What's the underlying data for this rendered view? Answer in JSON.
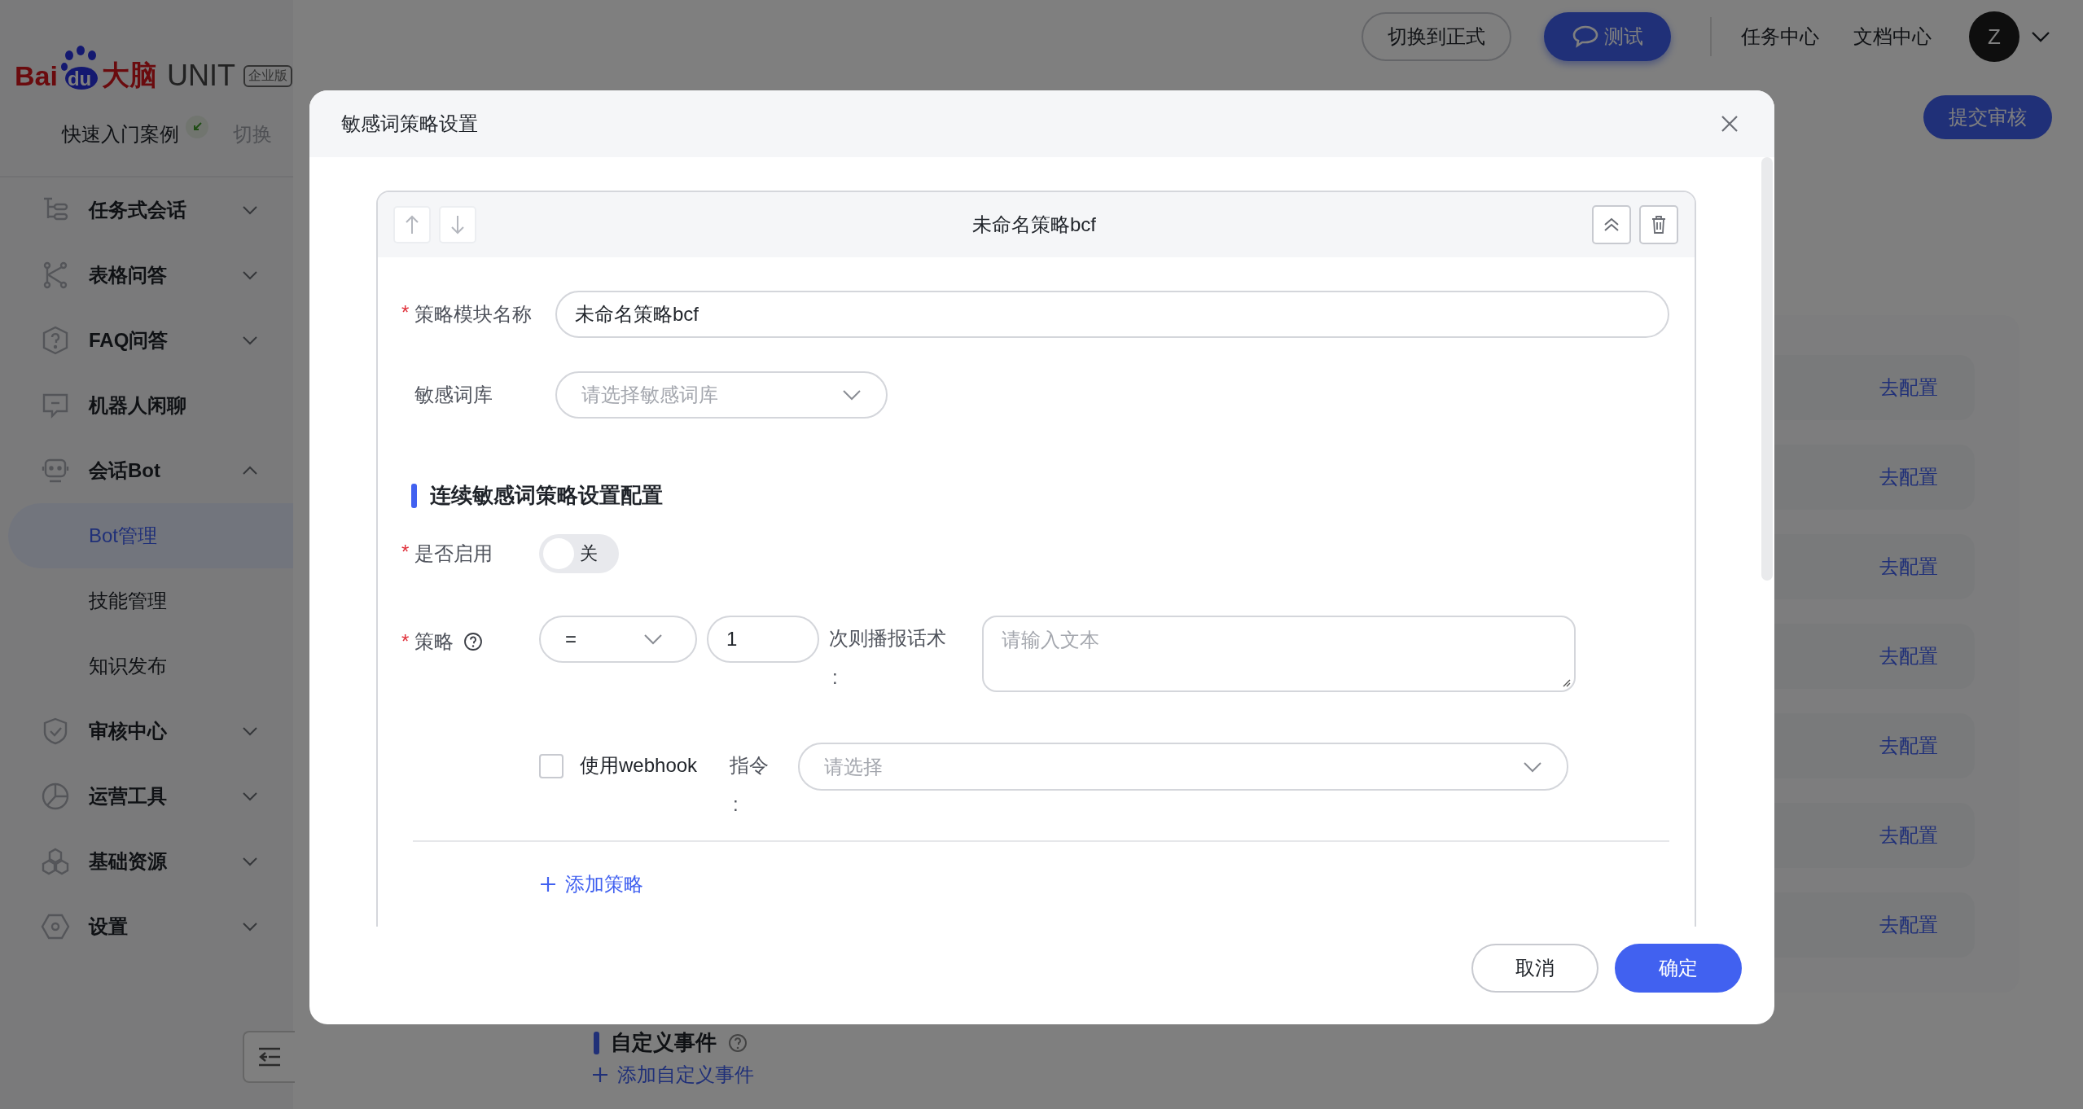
{
  "sidebar": {
    "logo": {
      "brand": "Bai",
      "paw_text": "du",
      "brand_cn": "大脑",
      "product": "UNIT",
      "edition": "企业版"
    },
    "quick_start": {
      "label": "快速入门案例",
      "switch": "切换"
    },
    "menu": [
      {
        "label": "任务式会话",
        "kind": "group",
        "expanded": false
      },
      {
        "label": "表格问答",
        "kind": "group",
        "expanded": false
      },
      {
        "label": "FAQ问答",
        "kind": "group",
        "expanded": false
      },
      {
        "label": "机器人闲聊",
        "kind": "link"
      },
      {
        "label": "会话Bot",
        "kind": "group",
        "expanded": true,
        "children": [
          {
            "label": "Bot管理",
            "selected": true
          },
          {
            "label": "技能管理",
            "selected": false
          },
          {
            "label": "知识发布",
            "selected": false
          }
        ]
      },
      {
        "label": "审核中心",
        "kind": "group",
        "expanded": false
      },
      {
        "label": "运营工具",
        "kind": "group",
        "expanded": false
      },
      {
        "label": "基础资源",
        "kind": "group",
        "expanded": false
      },
      {
        "label": "设置",
        "kind": "group",
        "expanded": false
      }
    ]
  },
  "header": {
    "switch_button": "切换到正式",
    "test_button": "测试",
    "links": [
      "任务中心",
      "文档中心"
    ],
    "avatar": "Z"
  },
  "page": {
    "submit_button": "提交审核",
    "config_links": [
      "去配置",
      "去配置",
      "去配置",
      "去配置",
      "去配置",
      "去配置",
      "去配置"
    ],
    "custom_event_title": "自定义事件",
    "add_custom_event": "添加自定义事件"
  },
  "modal": {
    "title": "敏感词策略设置",
    "card": {
      "title": "未命名策略bcf",
      "fields": [
        {
          "label": "策略模块名称",
          "required_mark": "*",
          "kind": "input",
          "value": "未命名策略bcf"
        },
        {
          "label": "敏感词库",
          "kind": "select",
          "placeholder": "请选择敏感词库"
        }
      ],
      "section_title": "连续敏感词策略设置配置",
      "enable": {
        "label": "是否启用",
        "required_mark": "*",
        "on": false,
        "state_text": "关"
      },
      "strategy": {
        "label": "策略",
        "required_mark": "*",
        "operator": "=",
        "count": "1",
        "reply_label": "次则播报话术",
        "reply_colon": ":",
        "reply_placeholder": "请输入文本",
        "webhook": {
          "label": "使用webhook",
          "checked": false
        },
        "command_label": "指令",
        "command_colon": ":",
        "command_placeholder": "请选择"
      },
      "add_strategy": "添加策略"
    },
    "buttons": [
      {
        "label": "取消",
        "kind": "secondary"
      },
      {
        "label": "确定",
        "kind": "primary"
      }
    ]
  }
}
